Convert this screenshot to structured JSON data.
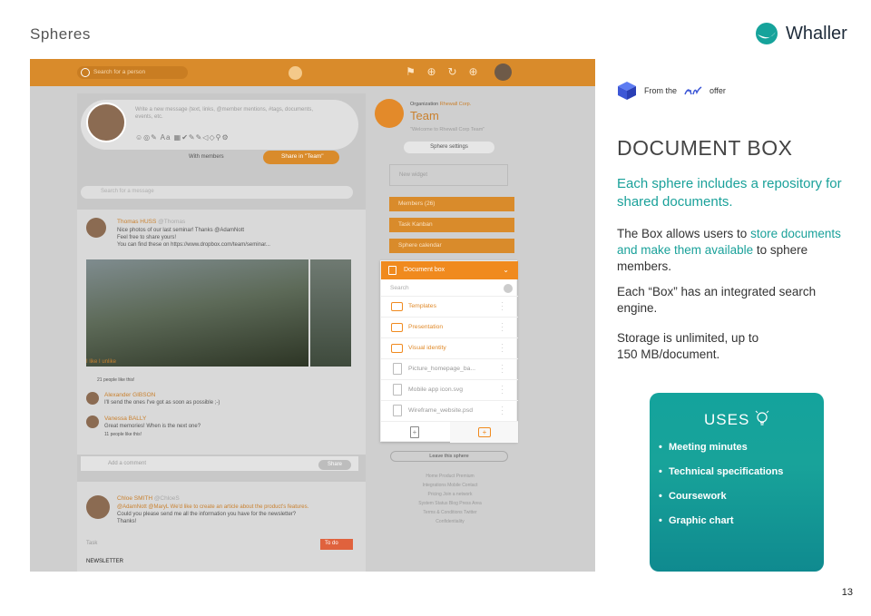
{
  "slide": {
    "section_title": "Spheres",
    "brand_name": "Whaller",
    "page_number": "13"
  },
  "colors": {
    "accent_orange": "#f08a1e",
    "teal": "#1aa19a",
    "brand_blue": "#1e2b3a"
  },
  "screenshot": {
    "topbar": {
      "search_placeholder": "Search for a person"
    },
    "composer": {
      "placeholder": "Write a new message (text, links, @member mentions, #tags, documents, events, etc.",
      "members_select": "With members",
      "share_button": "Share in \"Team\""
    },
    "feed_search_placeholder": "Search for a message",
    "post": {
      "author": "Thomas HUSS",
      "handle": "@Thomas",
      "line1": "Nice photos of our last seminar! Thanks @AdamNott",
      "line2": "Feel free to share yours!",
      "line3": "You can find these on https://www.dropbox.com/team/seminar...",
      "reactions": "I like  I unlike",
      "likes": "21 people like this!",
      "comments": [
        {
          "author": "Alexander GIBSON",
          "text": "I'll send the ones I've got as soon as possible ;-)"
        },
        {
          "author": "Vanessa BALLY",
          "text": "Great memories! When is the next one?",
          "likes": "11 people like this!"
        }
      ],
      "comment_placeholder": "Add a comment",
      "comment_share": "Share"
    },
    "post2": {
      "author": "Chloe SMITH",
      "handle": "@ChloeS",
      "line1": "@AdamNott @MaryL We'd like to create an article about the product's features.",
      "line2": "Could you please send me all the information you have for the newsletter?",
      "line3": "Thanks!",
      "task_label": "Task",
      "todo": "To do",
      "task_title": "NEWSLETTER"
    },
    "sidebar": {
      "org_label": "Organization",
      "org_name": "Rhewall Corp.",
      "sphere_name": "Team",
      "welcome": "\"Welcome to Rhewall Corp Team\"",
      "settings_button": "Sphere settings",
      "new_widget": "New widget",
      "members": "Members",
      "members_count": "(26)",
      "kanban": "Task Kanban",
      "calendar": "Sphere calendar",
      "leave": "Leave this sphere",
      "footer_links": [
        "Home  Product  Premium",
        "Integrations  Mobile  Contact",
        "Pricing  Join a network",
        "System Status  Blog  Press Area",
        "Terms & Conditions  Twitter",
        "Confidentiality"
      ]
    },
    "document_box": {
      "title": "Document box",
      "search_placeholder": "Search",
      "folders": [
        "Templates",
        "Presentation",
        "Visual identity"
      ],
      "files": [
        "Picture_homepage_ba...",
        "Mobile app icon.svg",
        "Wireframe_website.psd"
      ]
    }
  },
  "content": {
    "offer_prefix": "From the",
    "offer_suffix": "offer",
    "heading": "DOCUMENT BOX",
    "lead": "Each sphere includes a repository for shared documents.",
    "p1_before": "The Box allows users to ",
    "p1_highlight": "store documents and make them available",
    "p1_after": " to sphere members.",
    "p2": "Each “Box” has an integrated search engine.",
    "p3_line1": "Storage is unlimited, up to",
    "p3_line2": "150 MB/document."
  },
  "uses": {
    "title": "USES",
    "items": [
      "Meeting minutes",
      "Technical specifications",
      "Coursework",
      "Graphic chart"
    ]
  }
}
